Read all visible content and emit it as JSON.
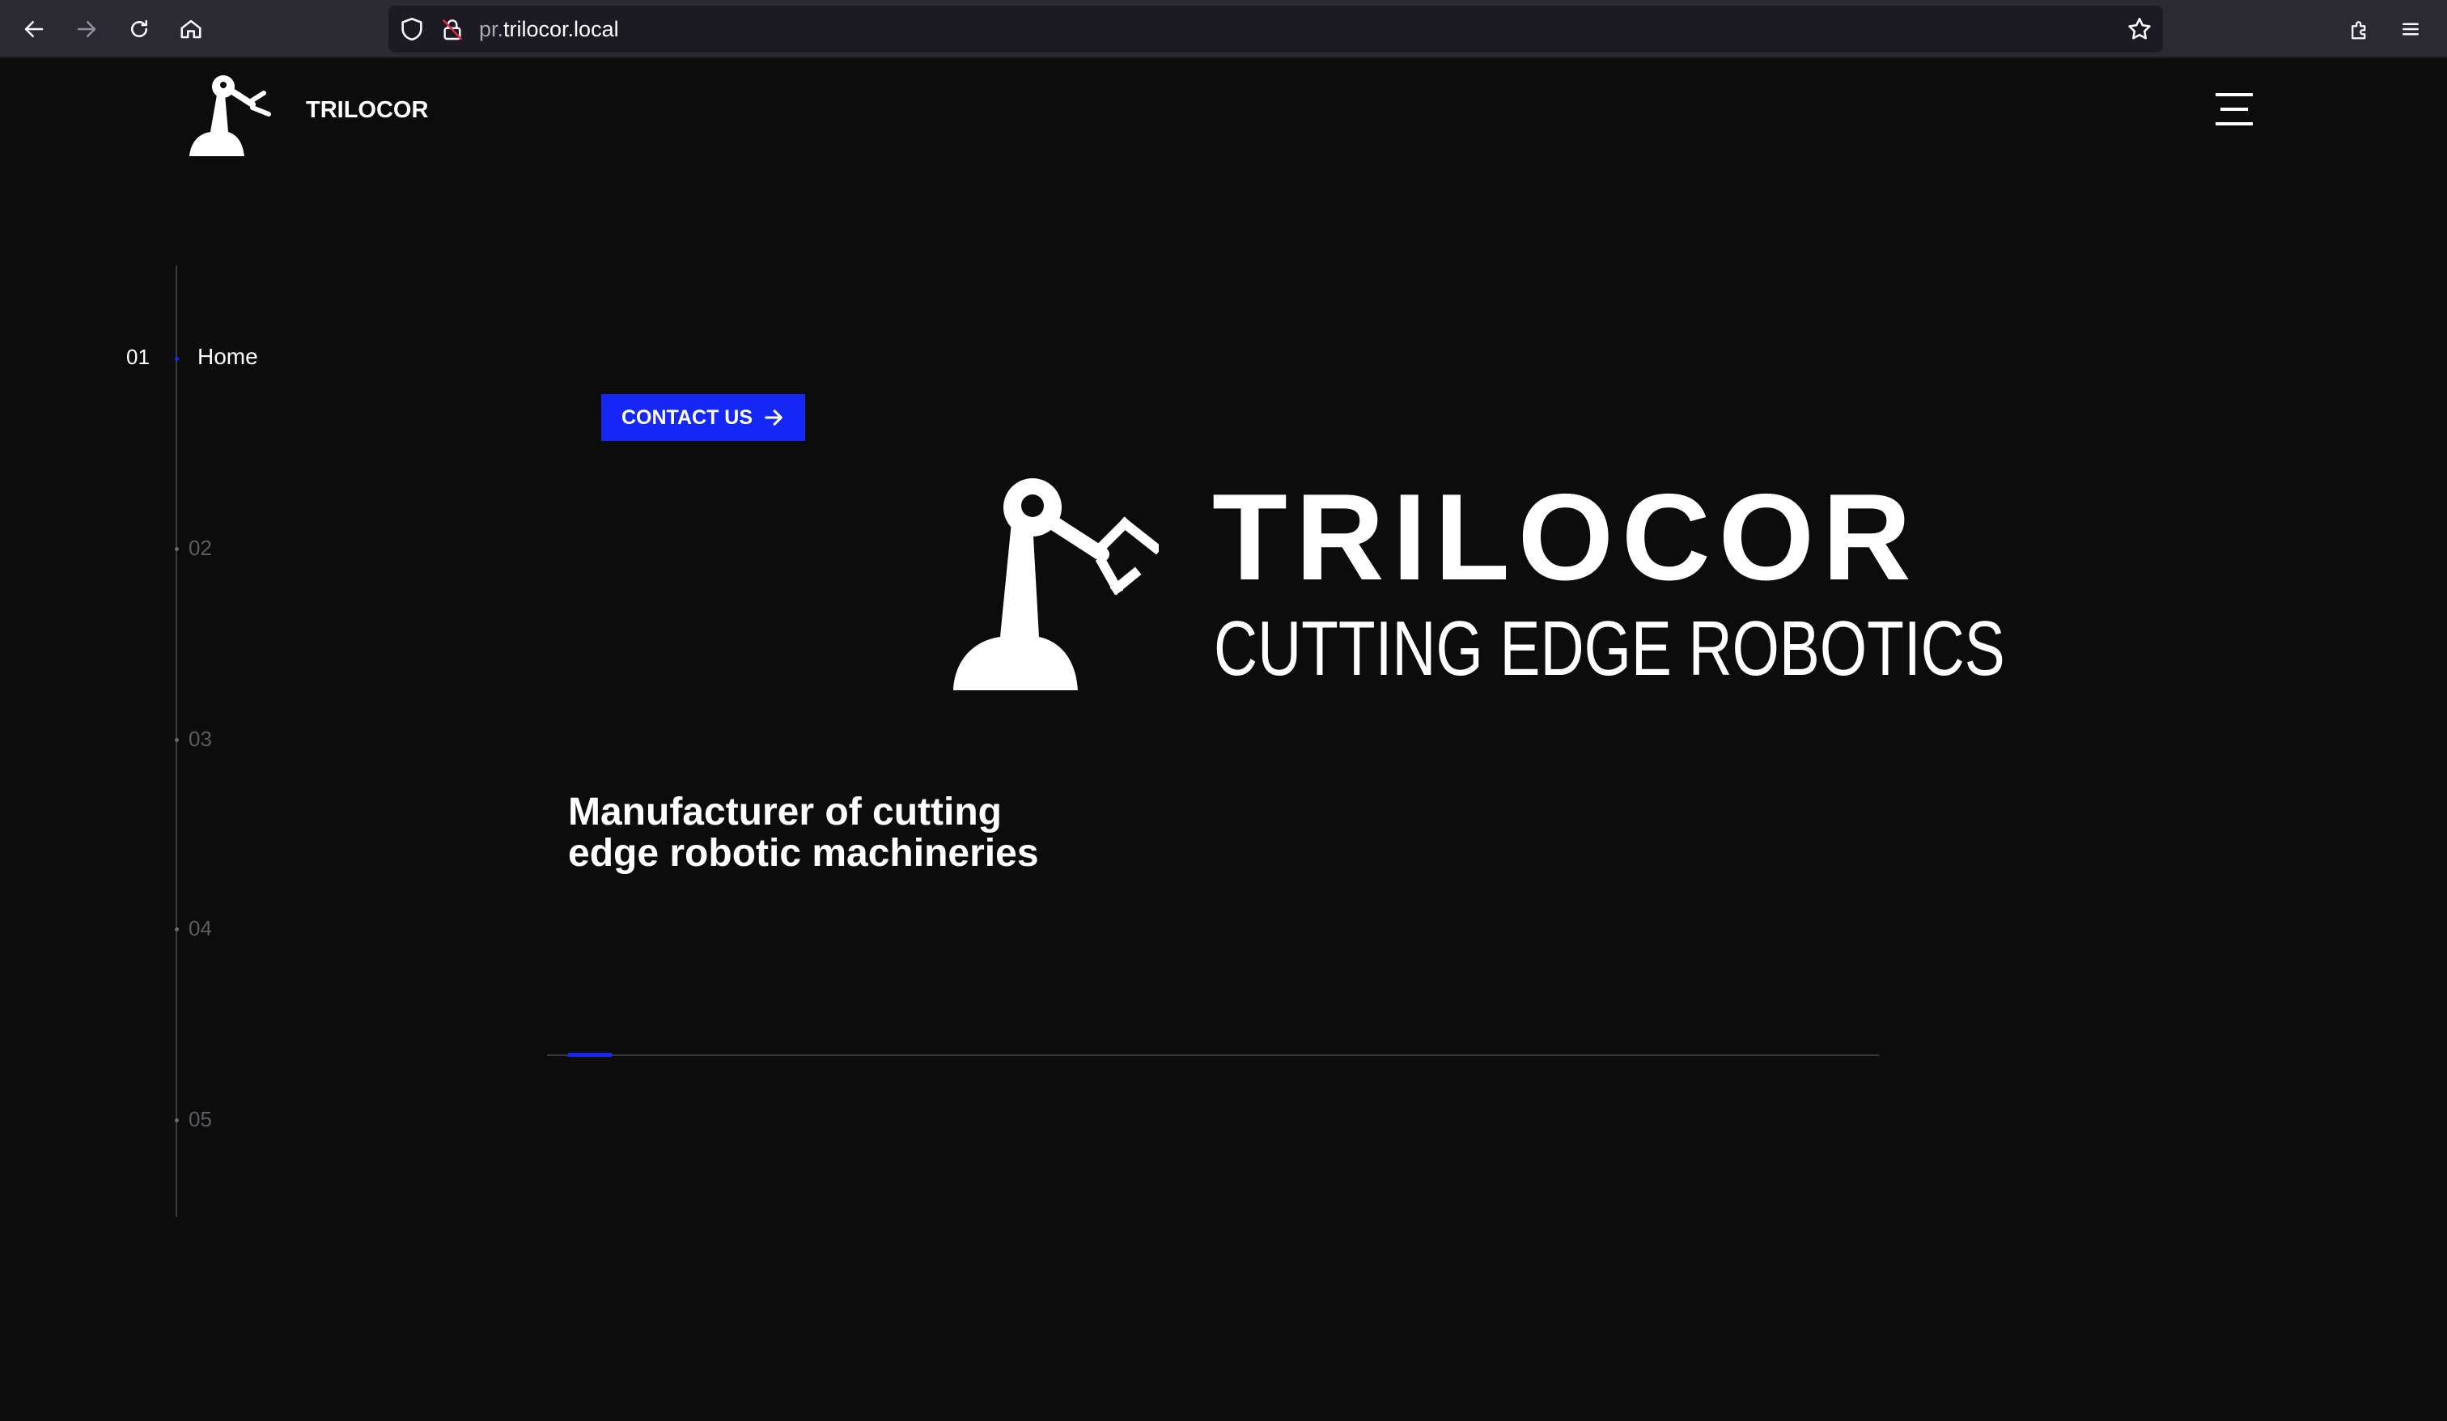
{
  "browser": {
    "url_subdomain": "pr.",
    "url_domain": "trilocor.local"
  },
  "header": {
    "brand": "TRILOCOR"
  },
  "side_nav": {
    "items": [
      {
        "number": "01",
        "label": "Home"
      },
      {
        "number": "02"
      },
      {
        "number": "03"
      },
      {
        "number": "04"
      },
      {
        "number": "05"
      }
    ]
  },
  "hero": {
    "contact_label": "CONTACT US",
    "title": "TRILOCOR",
    "subtitle": "CUTTING EDGE ROBOTICS",
    "tagline": "Manufacturer of cutting edge robotic machineries",
    "slide_progress": 0.033
  },
  "colors": {
    "background": "#0c0c0d",
    "accent": "#1427f5",
    "toolbar": "#2b2a33",
    "url_bar": "#1c1b22"
  },
  "icons": {
    "back": "arrow-left-icon",
    "forward": "arrow-right-icon",
    "reload": "reload-icon",
    "home": "home-icon",
    "tracking": "shield-icon",
    "insecure": "lock-strike-icon",
    "bookmark": "star-icon",
    "extensions": "puzzle-icon",
    "menu": "menu-icon",
    "logo": "robot-arm-logo",
    "contact_arrow": "arrow-right-icon"
  }
}
